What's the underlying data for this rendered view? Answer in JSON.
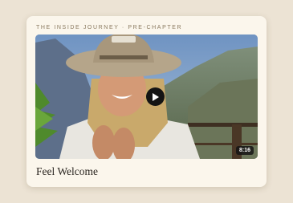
{
  "card": {
    "eyebrow": "THE INSIDE JOURNEY  ·  PRE-CHAPTER",
    "title": "Feel Welcome"
  },
  "video": {
    "duration": "8:16",
    "icon": "play-icon",
    "thumbnail": "smiling-man-in-hat-mountains"
  },
  "colors": {
    "background": "#ece3d4",
    "card": "#fbf6ec",
    "play_button": "#141414",
    "eyebrow_text": "#8a7a60"
  }
}
